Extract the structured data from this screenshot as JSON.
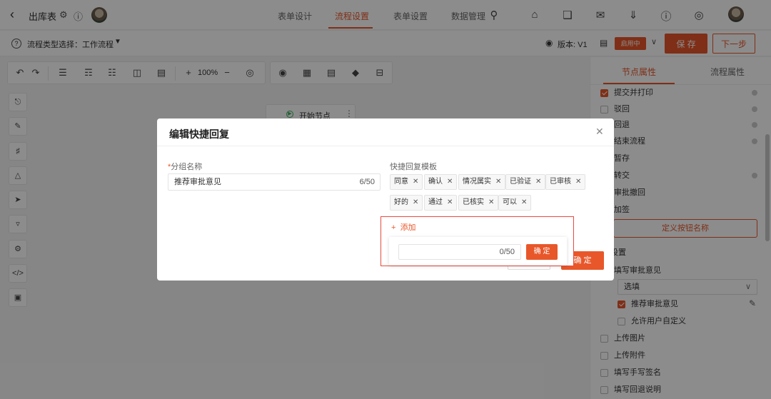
{
  "header": {
    "back_icon": "chevron-left-icon",
    "title": "出库表",
    "nav_tabs": [
      {
        "label": "表单设计"
      },
      {
        "label": "流程设置",
        "active": true
      },
      {
        "label": "表单设置"
      },
      {
        "label": "数据管理"
      }
    ]
  },
  "subbar": {
    "process_type_label": "流程类型选择：工作流程",
    "version_label": "版本: V1",
    "status_badge": "启用中",
    "save_label": "保 存",
    "next_label": "下一步"
  },
  "toolbar": {
    "zoom": "100%"
  },
  "start_node": {
    "label": "开始节点"
  },
  "right_panel": {
    "tabs": [
      "节点属性",
      "流程属性"
    ],
    "items": [
      {
        "label": "提交并打印",
        "checked": true
      },
      {
        "label": "驳回",
        "checked": false
      },
      {
        "label": "回退",
        "checked": false
      },
      {
        "label": "结束流程",
        "checked": false
      },
      {
        "label": "暂存",
        "checked": false
      },
      {
        "label": "转交",
        "checked": false
      },
      {
        "label": "审批撤回",
        "checked": false
      },
      {
        "label": "加签",
        "checked": false
      }
    ],
    "define_button_label": "定义按钮名称",
    "settings_heading": "设置",
    "fill_opinion_label": "填写审批意见",
    "select_value": "选填",
    "recommend_label": "推荐审批意见",
    "allow_custom_label": "允许用户自定义",
    "upload_image_label": "上传图片",
    "upload_attachment_label": "上传附件",
    "handwritten_label": "填写手写签名",
    "return_reason_label": "填写回退说明"
  },
  "dialog": {
    "title": "编辑快捷回复",
    "group_name_label": "分组名称",
    "group_name_value": "推荐审批意见",
    "group_name_count": "6/50",
    "template_label": "快捷回复模板",
    "tags": [
      "同意",
      "确认",
      "情况属实",
      "已验证",
      "已审核",
      "好的",
      "通过",
      "已核实",
      "可以"
    ],
    "add_label": "添加",
    "add_count": "0/50",
    "add_confirm_label": "确 定",
    "confirm_label": "确 定"
  },
  "colors": {
    "accent": "#e8572a",
    "highlight_border": "#e94a3f"
  }
}
